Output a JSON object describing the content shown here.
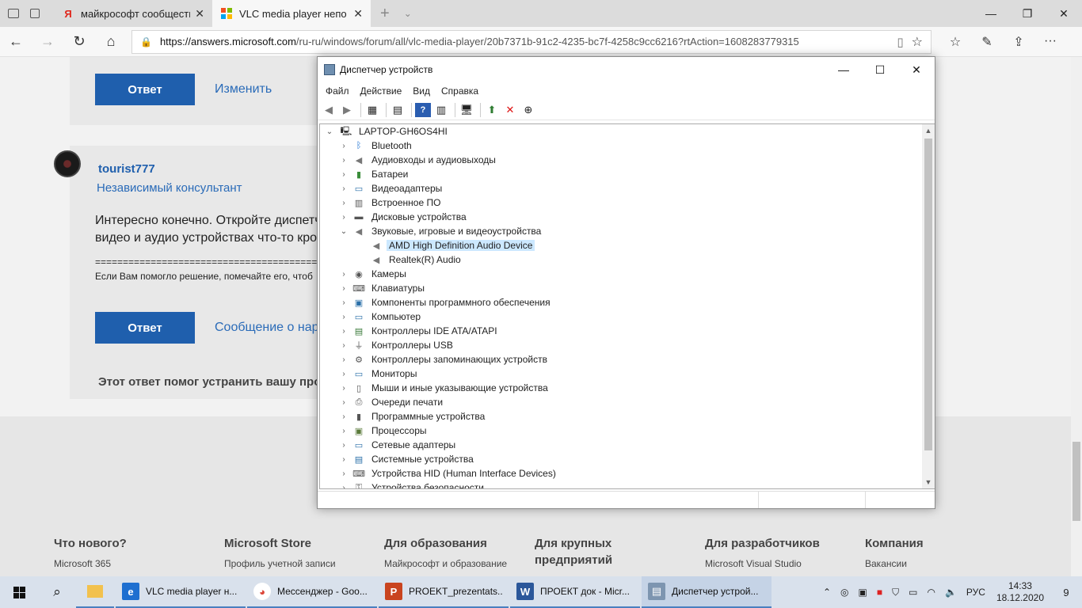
{
  "browser": {
    "tabs": [
      {
        "title": "майкрософт сообщество –",
        "favicon": "yandex-icon",
        "active": false
      },
      {
        "title": "VLC media player непо",
        "favicon": "microsoft-icon",
        "active": true
      }
    ],
    "url_host": "https://answers.microsoft.com",
    "url_rest": "/ru-ru/windows/forum/all/vlc-media-player/20b7371b-91c2-4235-bc7f-4258c9cc6216?rtAction=1608283779315"
  },
  "page": {
    "reply1_label": "Ответ",
    "edit_link": "Изменить",
    "user_name": "tourist777",
    "user_role": "Независимый консультант",
    "body_line1": "Интересно конечно. Откройте диспетч",
    "body_line2": "видео и аудио устройствах что-то кром",
    "separator": "==========================================",
    "signature": "Если Вам помогло решение, помечайте его, чтоб",
    "reply2_label": "Ответ",
    "report_link": "Сообщение о нар",
    "helped_text": "Этот ответ помог устранить вашу про"
  },
  "footer": [
    {
      "heading": "Что нового?",
      "link": "Microsoft 365"
    },
    {
      "heading": "Microsoft Store",
      "link": "Профиль учетной записи"
    },
    {
      "heading": "Для образования",
      "link": "Майкрософт и образование"
    },
    {
      "heading": "Для крупных предприятий",
      "link": ""
    },
    {
      "heading": "Для разработчиков",
      "link": "Microsoft Visual Studio"
    },
    {
      "heading": "Компания",
      "link": "Вакансии"
    }
  ],
  "device_manager": {
    "title": "Диспетчер устройств",
    "menu": [
      "Файл",
      "Действие",
      "Вид",
      "Справка"
    ],
    "root": "LAPTOP-GH6OS4HI",
    "items": [
      {
        "label": "Bluetooth",
        "icon": "bluetooth-icon"
      },
      {
        "label": "Аудиовходы и аудиовыходы",
        "icon": "speaker-icon"
      },
      {
        "label": "Батареи",
        "icon": "battery-icon"
      },
      {
        "label": "Видеоадаптеры",
        "icon": "display-adapter-icon"
      },
      {
        "label": "Встроенное ПО",
        "icon": "firmware-icon"
      },
      {
        "label": "Дисковые устройства",
        "icon": "disk-icon"
      },
      {
        "label": "Звуковые, игровые и видеоустройства",
        "icon": "speaker-icon",
        "expanded": true
      },
      {
        "label": "AMD High Definition Audio Device",
        "icon": "speaker-icon",
        "child": true,
        "selected": true
      },
      {
        "label": "Realtek(R) Audio",
        "icon": "speaker-icon",
        "child": true
      },
      {
        "label": "Камеры",
        "icon": "camera-icon"
      },
      {
        "label": "Клавиатуры",
        "icon": "keyboard-icon"
      },
      {
        "label": "Компоненты программного обеспечения",
        "icon": "software-component-icon"
      },
      {
        "label": "Компьютер",
        "icon": "computer-icon"
      },
      {
        "label": "Контроллеры IDE ATA/ATAPI",
        "icon": "ide-controller-icon"
      },
      {
        "label": "Контроллеры USB",
        "icon": "usb-icon"
      },
      {
        "label": "Контроллеры запоминающих устройств",
        "icon": "storage-controller-icon"
      },
      {
        "label": "Мониторы",
        "icon": "monitor-icon"
      },
      {
        "label": "Мыши и иные указывающие устройства",
        "icon": "mouse-icon"
      },
      {
        "label": "Очереди печати",
        "icon": "printer-icon"
      },
      {
        "label": "Программные устройства",
        "icon": "software-device-icon"
      },
      {
        "label": "Процессоры",
        "icon": "processor-icon"
      },
      {
        "label": "Сетевые адаптеры",
        "icon": "network-adapter-icon"
      },
      {
        "label": "Системные устройства",
        "icon": "system-device-icon"
      },
      {
        "label": "Устройства HID (Human Interface Devices)",
        "icon": "hid-icon"
      },
      {
        "label": "Устройства безопасности",
        "icon": "security-device-icon"
      }
    ]
  },
  "taskbar": {
    "apps": [
      {
        "label": "VLC media player н...",
        "icon": "edge-icon"
      },
      {
        "label": "Мессенджер - Goo...",
        "icon": "chrome-icon"
      },
      {
        "label": "PROEKT_prezentats...",
        "icon": "powerpoint-icon"
      },
      {
        "label": "ПРОЕКТ док - Micr...",
        "icon": "word-icon"
      },
      {
        "label": "Диспетчер устрой...",
        "icon": "device-manager-icon"
      }
    ],
    "lang": "РУС",
    "time": "14:33",
    "date": "18.12.2020",
    "notifications": "9"
  }
}
